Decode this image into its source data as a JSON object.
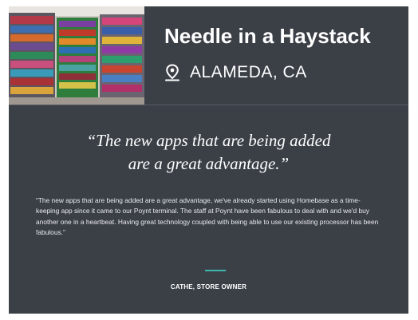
{
  "store": {
    "name": "Needle in a Haystack",
    "location": "ALAMEDA, CA",
    "location_icon": "map-pin-icon",
    "photo": "store-shelves-photo"
  },
  "testimonial": {
    "headline_line1": "“The new apps that are being added",
    "headline_line2": "are a great advantage.”",
    "body": "“The new apps that are being added are a great advantage, we've already started using Homebase as a time-keeping app since it came to our Poynt terminal. The staff at Poynt have been fabulous to deal with and we'd buy another one in a heartbeat. Having great technology coupled with being able to use our existing processor has been fabulous.”",
    "attribution": "CATHE, STORE OWNER"
  },
  "colors": {
    "card_background": "#3b4047",
    "accent": "#3fb8b2",
    "text": "#ffffff"
  }
}
